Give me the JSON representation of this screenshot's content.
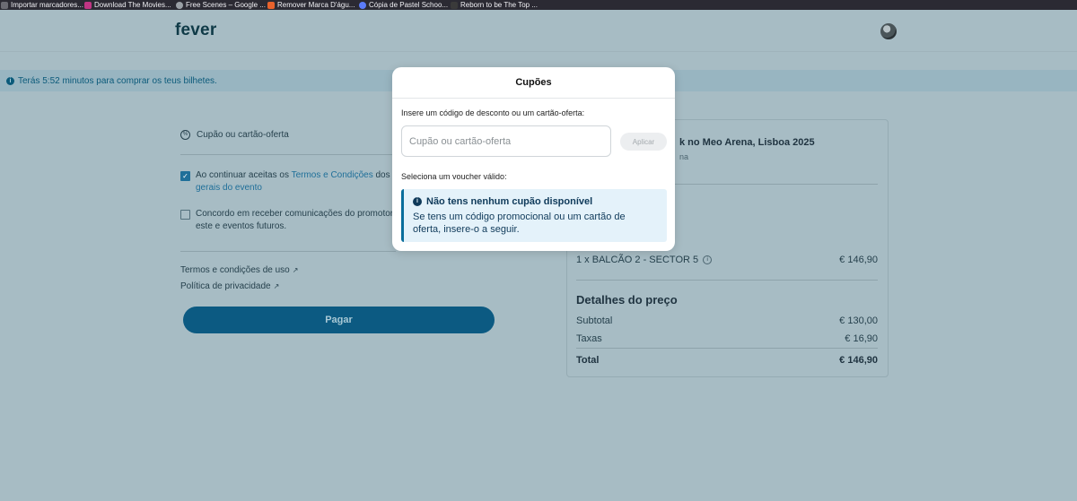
{
  "bookmarks": [
    {
      "label": "Importar marcadores...",
      "icon": "import-icon",
      "color": "#6b6b73"
    },
    {
      "label": "Download The Movies...",
      "icon": "movies-icon",
      "color": "#c13584"
    },
    {
      "label": "Free Scenes – Google ...",
      "icon": "globe-icon",
      "color": "#9aa0a6"
    },
    {
      "label": "Remover Marca D'águ...",
      "icon": "watermark-icon",
      "color": "#e8622c"
    },
    {
      "label": "Cópia de Pastel Schoo...",
      "icon": "shield-icon",
      "color": "#5b7cfa"
    },
    {
      "label": "Reborn to be The Top ...",
      "icon": "book-icon",
      "color": "#3a3a3a"
    }
  ],
  "header": {
    "logo": "fever"
  },
  "timer": {
    "text": "Terás 5:52 minutos para comprar os teus bilhetes."
  },
  "left": {
    "coupon_label": "Cupão ou cartão-oferta",
    "terms_prefix": "Ao continuar aceitas os ",
    "terms_link": "Termos e Condições",
    "terms_suffix": " dos b",
    "terms_line2": "gerais do evento",
    "comms_line1": "Concordo em receber comunicações do promotor",
    "comms_line2": "este e eventos futuros.",
    "footer_terms": "Termos e condições de uso",
    "footer_privacy": "Política de privacidade",
    "pay_label": "Pagar"
  },
  "order": {
    "event_title": "k no Meo Arena, Lisboa 2025",
    "event_sub": "na",
    "item": "1 x BALCÃO 2 - SECTOR 5",
    "item_price": "€ 146,90",
    "price_title": "Detalhes do preço",
    "subtotal_label": "Subtotal",
    "subtotal_value": "€ 130,00",
    "taxes_label": "Taxas",
    "taxes_value": "€ 16,90",
    "total_label": "Total",
    "total_value": "€ 146,90"
  },
  "modal": {
    "title": "Cupões",
    "code_label": "Insere um código de desconto ou um cartão-oferta:",
    "input_placeholder": "Cupão ou cartão-oferta",
    "apply_label": "Aplicar",
    "voucher_label": "Seleciona um voucher válido:",
    "alert_title": "Não tens nenhum cupão disponível",
    "alert_text": "Se tens um código promocional ou um cartão de oferta, insere-o a seguir."
  },
  "colors": {
    "brand": "#0c5a82",
    "overlay": "#a7bcc4",
    "alert_bg": "#e4f2fa"
  }
}
